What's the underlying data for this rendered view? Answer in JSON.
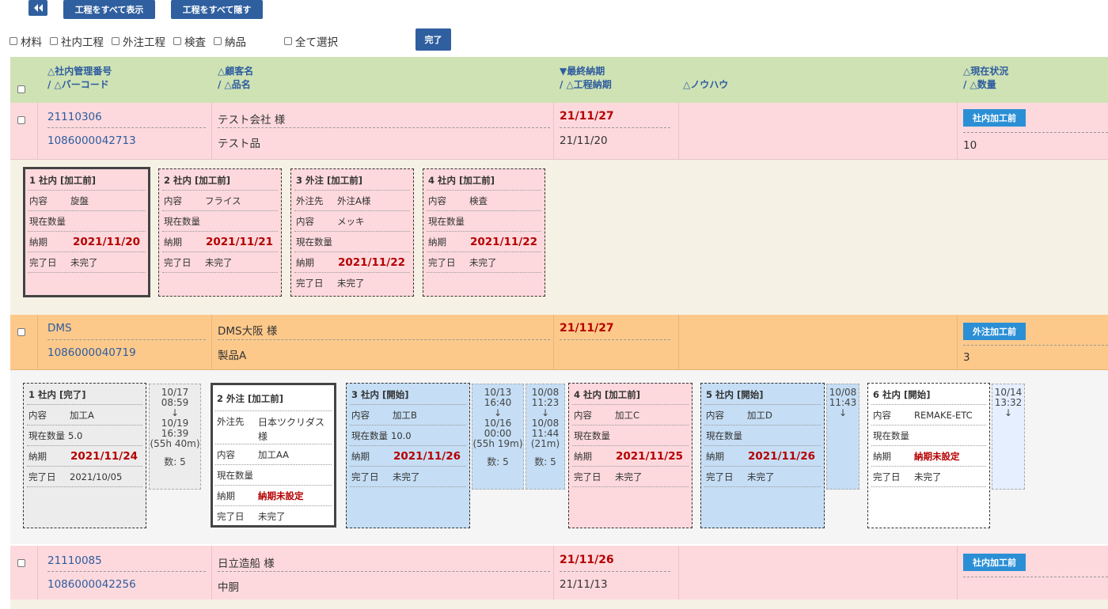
{
  "toolbar": {
    "back_icon": "double-left-arrow-icon",
    "show_all": "工程をすべて表示",
    "hide_all": "工程をすべて隠す",
    "done": "完了"
  },
  "filters": [
    "材料",
    "社内工程",
    "外注工程",
    "検査",
    "納品"
  ],
  "select_all": "全て選択",
  "header": {
    "mgmt_no": "△社内管理番号",
    "barcode": "/ △バーコード",
    "customer": "△顧客名",
    "product": "/ △品名",
    "final_due": "▼最終納期",
    "process_due": "/ △工程納期",
    "knowhow": "△ノウハウ",
    "status": "△現在状況",
    "quantity": "/ △数量"
  },
  "labels": {
    "content": "内容",
    "qty": "現在数量",
    "due": "納期",
    "done_date": "完了日",
    "vendor": "外注先",
    "count_prefix": "数: "
  },
  "orders": [
    {
      "mgmt_no": "21110306",
      "barcode": "1086000042713",
      "customer": "テスト会社 様",
      "product": "テスト品",
      "final_due": "21/11/27",
      "process_due": "21/11/20",
      "status": "社内加工前",
      "quantity": "10",
      "processes": [
        {
          "title": "1 社内 [加工前]",
          "content": "旋盤",
          "qty": "",
          "due": "2021/11/20",
          "done": "未完了"
        },
        {
          "title": "2 社内 [加工前]",
          "content": "フライス",
          "qty": "",
          "due": "2021/11/21",
          "done": "未完了"
        },
        {
          "title": "3 外注 [加工前]",
          "vendor": "外注A様",
          "content": "メッキ",
          "qty": "",
          "due": "2021/11/22",
          "done": "未完了"
        },
        {
          "title": "4 社内 [加工前]",
          "content": "検査",
          "qty": "",
          "due": "2021/11/22",
          "done": "未完了"
        }
      ]
    },
    {
      "mgmt_no": "DMS",
      "barcode": "1086000040719",
      "customer": "DMS大阪 様",
      "product": "製品A",
      "final_due": "21/11/27",
      "process_due": "",
      "status": "外注加工前",
      "quantity": "3",
      "processes": [
        {
          "title": "1 社内 [完了]",
          "content": "加工A",
          "qty": "5.0",
          "due": "2021/11/24",
          "done": "2021/10/05"
        },
        {
          "title": "2 外注 [加工前]",
          "vendor": "日本ツクリダス",
          "vendor2": "様",
          "content": "加工AA",
          "qty": "",
          "due": "納期未設定",
          "done": "未完了"
        },
        {
          "title": "3 社内 [開始]",
          "content": "加工B",
          "qty": "10.0",
          "due": "2021/11/26",
          "done": "未完了"
        },
        {
          "title": "4 社内 [加工前]",
          "content": "加工C",
          "qty": "",
          "due": "2021/11/25",
          "done": "未完了"
        },
        {
          "title": "5 社内 [開始]",
          "content": "加工D",
          "qty": "",
          "due": "2021/11/26",
          "done": "未完了"
        },
        {
          "title": "6 社内 [開始]",
          "content": "REMAKE-ETC",
          "qty": "",
          "due": "納期未設定",
          "done": "未完了"
        }
      ],
      "timelogs": [
        {
          "start_d": "10/17",
          "start_t": "08:59",
          "arrow": "↓",
          "end_d": "10/19",
          "end_t": "16:39",
          "dur": "(55h 40m)",
          "count": "5"
        },
        {
          "start_d": "10/13",
          "start_t": "16:40",
          "arrow": "↓",
          "end_d": "10/16",
          "end_t": "00:00",
          "dur": "(55h 19m)",
          "count": "5"
        },
        {
          "start_d": "10/08",
          "start_t": "11:23",
          "arrow": "↓",
          "end_d": "10/08",
          "end_t": "11:44",
          "dur": "(21m)",
          "count": "5"
        },
        {
          "start_d": "10/08",
          "start_t": "11:43",
          "arrow": "↓"
        },
        {
          "start_d": "10/14",
          "start_t": "13:32",
          "arrow": "↓"
        }
      ]
    },
    {
      "mgmt_no": "21110085",
      "barcode": "1086000042256",
      "customer": "日立造船 様",
      "product": "中胴",
      "final_due": "21/11/26",
      "process_due": "21/11/13",
      "status": "社内加工前"
    }
  ]
}
